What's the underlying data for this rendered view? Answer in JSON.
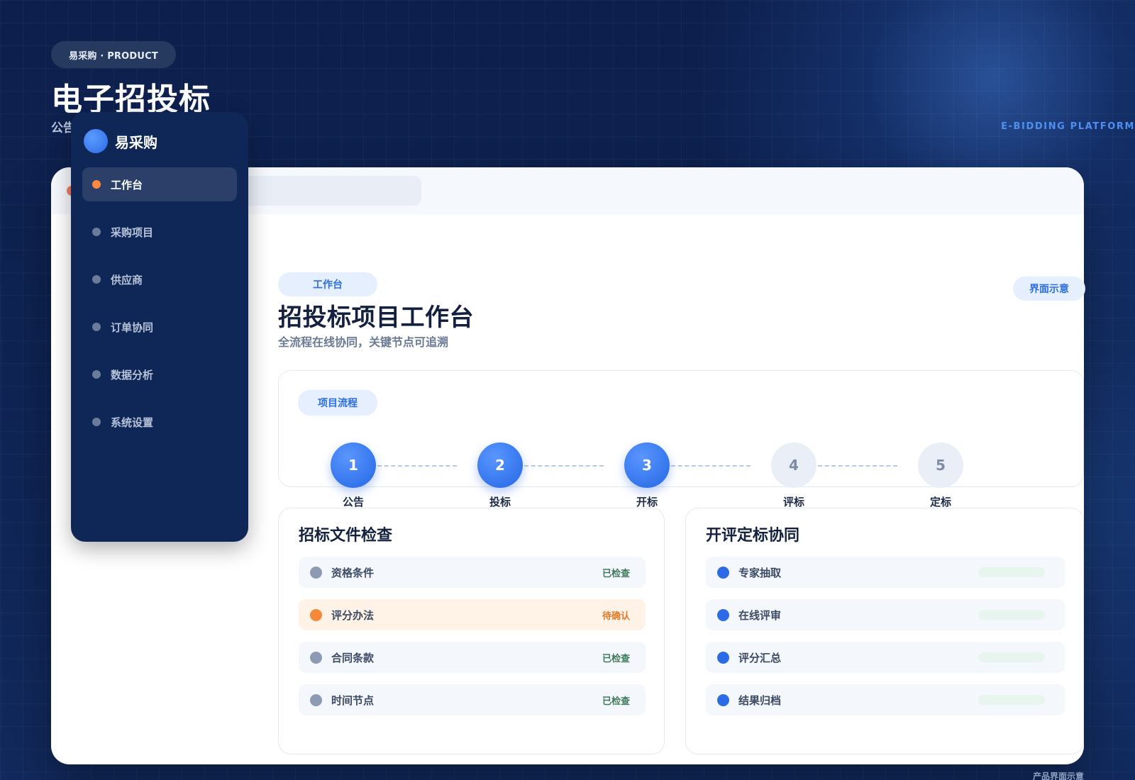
{
  "header": {
    "chip": "易采购 · PRODUCT",
    "title": "电子招投标",
    "subtitle": "公告",
    "platform_label": "E-BIDDING PLATFORM",
    "footer_note": "产品界面示意"
  },
  "sidebar": {
    "brand": "易采购",
    "items": [
      {
        "label": "工作台",
        "active": true
      },
      {
        "label": "采购项目",
        "active": false
      },
      {
        "label": "供应商",
        "active": false
      },
      {
        "label": "订单协同",
        "active": false
      },
      {
        "label": "数据分析",
        "active": false
      },
      {
        "label": "系统设置",
        "active": false
      }
    ]
  },
  "main": {
    "section_pill": "工作台",
    "demo_badge": "界面示意",
    "title": "招投标项目工作台",
    "subtitle": "全流程在线协同，关键节点可追溯"
  },
  "flow": {
    "pill": "项目流程",
    "steps": [
      {
        "num": "1",
        "label": "公告",
        "done": true
      },
      {
        "num": "2",
        "label": "投标",
        "done": true
      },
      {
        "num": "3",
        "label": "开标",
        "done": true
      },
      {
        "num": "4",
        "label": "评标",
        "done": false
      },
      {
        "num": "5",
        "label": "定标",
        "done": false
      }
    ]
  },
  "check_panel": {
    "title": "招标文件检查",
    "rows": [
      {
        "label": "资格条件",
        "status": "已检查"
      },
      {
        "label": "评分办法",
        "status": "待确认"
      },
      {
        "label": "合同条款",
        "status": "已检查"
      },
      {
        "label": "时间节点",
        "status": "已检查"
      }
    ]
  },
  "eval_panel": {
    "title": "开评定标协同",
    "rows": [
      {
        "label": "专家抽取"
      },
      {
        "label": "在线评审"
      },
      {
        "label": "评分汇总"
      },
      {
        "label": "结果归档"
      }
    ]
  },
  "colors": {
    "accent": "#2d6be6",
    "warning": "#f08a3c",
    "success_text": "#3f7a5c",
    "sidebar_bg": "#0e2757",
    "page_bg": "#0b1d47"
  }
}
